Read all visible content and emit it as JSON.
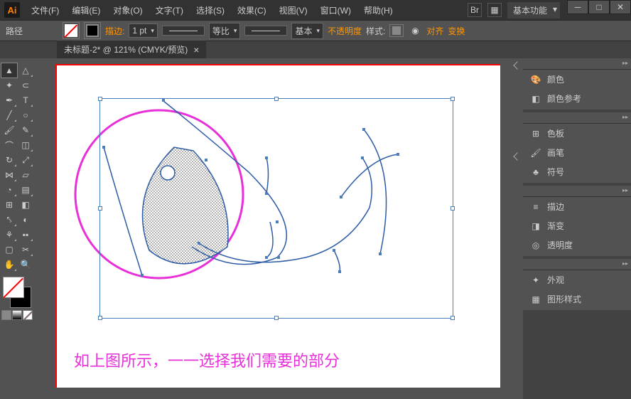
{
  "app": {
    "logo": "Ai"
  },
  "menu": [
    {
      "label": "文件(F)"
    },
    {
      "label": "编辑(E)"
    },
    {
      "label": "对象(O)"
    },
    {
      "label": "文字(T)"
    },
    {
      "label": "选择(S)"
    },
    {
      "label": "效果(C)"
    },
    {
      "label": "视图(V)"
    },
    {
      "label": "窗口(W)"
    },
    {
      "label": "帮助(H)"
    }
  ],
  "workspace": "基本功能",
  "controlbar": {
    "context": "路径",
    "stroke_label": "描边:",
    "stroke_pt": "1 pt",
    "proportional": "等比",
    "style_basic": "基本",
    "opacity": "不透明度",
    "style_label": "样式:",
    "align": "对齐",
    "transform": "变换"
  },
  "tab": {
    "title": "未标题-2* @ 121% (CMYK/预览)",
    "close": "×"
  },
  "panels": {
    "g1": [
      {
        "icon": "🎨",
        "label": "颜色"
      },
      {
        "icon": "◧",
        "label": "颜色参考"
      }
    ],
    "g2": [
      {
        "icon": "⊞",
        "label": "色板"
      },
      {
        "icon": "🖌",
        "label": "画笔"
      },
      {
        "icon": "♣",
        "label": "符号"
      }
    ],
    "g3": [
      {
        "icon": "≡",
        "label": "描边"
      },
      {
        "icon": "◨",
        "label": "渐变"
      },
      {
        "icon": "◎",
        "label": "透明度"
      }
    ],
    "g4": [
      {
        "icon": "✦",
        "label": "外观"
      },
      {
        "icon": "▦",
        "label": "图形样式"
      }
    ]
  },
  "annotation": "如上图所示，一一选择我们需要的部分"
}
